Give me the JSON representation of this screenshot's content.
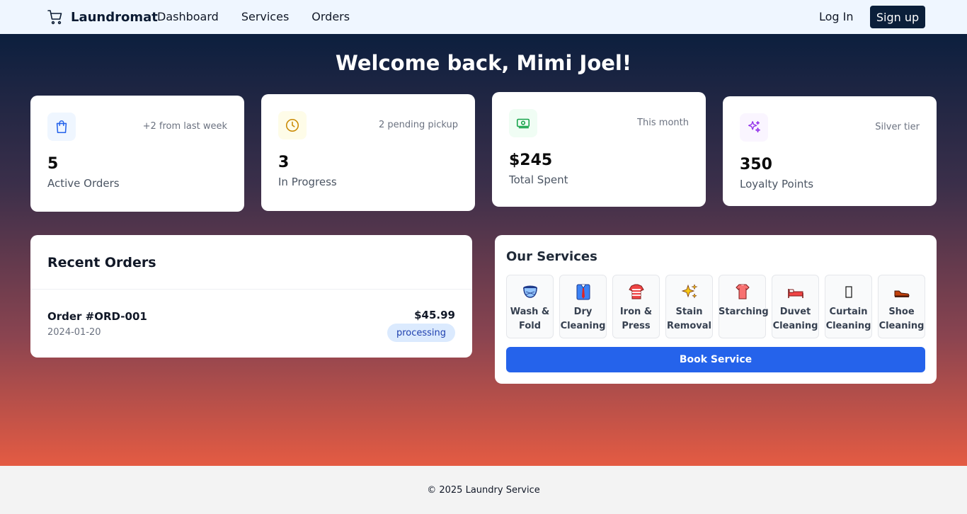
{
  "nav": {
    "brand": "Laundromat",
    "links": [
      "Dashboard",
      "Services",
      "Orders"
    ],
    "login": "Log In",
    "signup": "Sign up"
  },
  "hero": {
    "welcome": "Welcome back, Mimi Joel!"
  },
  "stats": [
    {
      "icon": "shopping-bag-icon",
      "note": "+2 from last week",
      "value": "5",
      "label": "Active Orders",
      "color": "#2563eb"
    },
    {
      "icon": "clock-icon",
      "note": "2 pending pickup",
      "value": "3",
      "label": "In Progress",
      "color": "#ca8a04"
    },
    {
      "icon": "banknote-icon",
      "note": "This month",
      "value": "$245",
      "label": "Total Spent",
      "color": "#16a34a"
    },
    {
      "icon": "sparkles-icon",
      "note": "Silver tier",
      "value": "350",
      "label": "Loyalty Points",
      "color": "#9333ea"
    }
  ],
  "recent_orders": {
    "title": "Recent Orders",
    "items": [
      {
        "id": "Order #ORD-001",
        "date": "2024-01-20",
        "amount": "$45.99",
        "status": "processing"
      }
    ]
  },
  "services": {
    "title": "Our Services",
    "items": [
      {
        "label": "Wash & Fold",
        "icon": "washer-icon"
      },
      {
        "label": "Dry Cleaning",
        "icon": "suit-icon"
      },
      {
        "label": "Iron & Press",
        "icon": "shirt-icon"
      },
      {
        "label": "Stain Removal",
        "icon": "sparkle-icon"
      },
      {
        "label": "Starching",
        "icon": "tshirt-icon"
      },
      {
        "label": "Duvet Cleaning",
        "icon": "bed-icon"
      },
      {
        "label": "Curtain Cleaning",
        "icon": "curtain-icon"
      },
      {
        "label": "Shoe Cleaning",
        "icon": "shoe-icon"
      }
    ],
    "book_label": "Book Service"
  },
  "footer": {
    "text": "© 2025 Laundry Service"
  }
}
